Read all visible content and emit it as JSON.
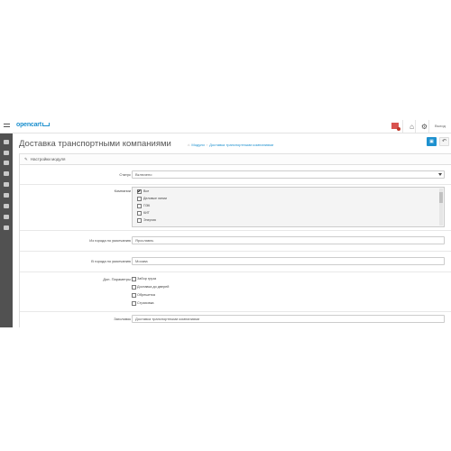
{
  "header": {
    "logo": "opencart",
    "logout_label": "Выход"
  },
  "sidebar": {
    "items": [
      "dashboard-icon",
      "catalog-icon",
      "extensions-icon",
      "design-icon",
      "sales-icon",
      "customers-icon",
      "marketing-icon",
      "system-icon",
      "reports-icon"
    ]
  },
  "page": {
    "title": "Доставка транспортными компаниями",
    "breadcrumb": [
      "Модули",
      "Доставка транспортными компаниями"
    ],
    "panel_title": "Настройки модуля"
  },
  "form": {
    "status": {
      "label": "Статус",
      "value": "Включено"
    },
    "companies": {
      "label": "Компании",
      "items": [
        {
          "label": "Все",
          "checked": true
        },
        {
          "label": "Деловые линии",
          "checked": false
        },
        {
          "label": "ПЭК",
          "checked": false
        },
        {
          "label": "КИТ",
          "checked": false
        },
        {
          "label": "Энергия",
          "checked": false
        }
      ]
    },
    "from_city": {
      "label": "Из города по умолчанию",
      "value": "Ярославль"
    },
    "to_city": {
      "label": "В города по умолчанию",
      "value": "Москва"
    },
    "extra": {
      "label": "Доп. Параметры",
      "items": [
        {
          "label": "Забор груза",
          "checked": false
        },
        {
          "label": "Доставка до дверей",
          "checked": false
        },
        {
          "label": "Обрешетка",
          "checked": false
        },
        {
          "label": "Страховка",
          "checked": false
        }
      ]
    },
    "heading": {
      "label": "Заголовок",
      "value": "Доставка транспортными компаниями"
    }
  },
  "colors": {
    "accent": "#1e91cf",
    "sidebar": "#515151"
  }
}
